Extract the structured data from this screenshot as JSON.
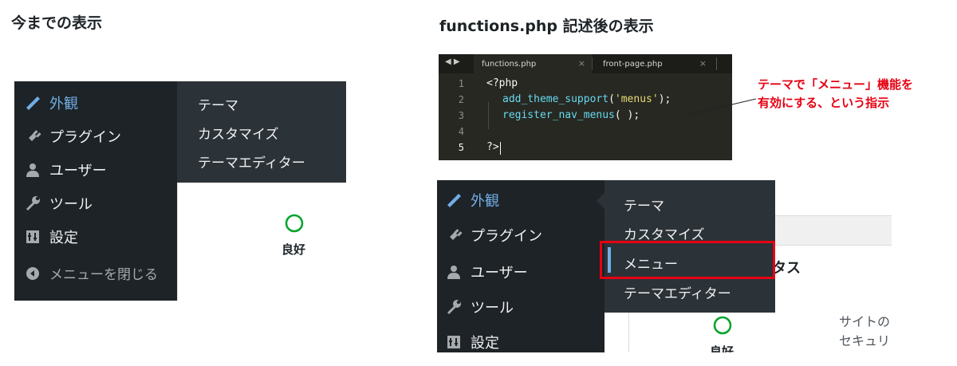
{
  "left_panel": {
    "heading": "今までの表示",
    "menu": [
      {
        "label": "外観",
        "icon": "paintbrush-icon",
        "active": true
      },
      {
        "label": "プラグイン",
        "icon": "plugin-icon"
      },
      {
        "label": "ユーザー",
        "icon": "user-icon"
      },
      {
        "label": "ツール",
        "icon": "wrench-icon"
      },
      {
        "label": "設定",
        "icon": "settings-icon"
      },
      {
        "label": "メニューを閉じる",
        "icon": "collapse-arrow-icon"
      }
    ],
    "submenu": [
      "テーマ",
      "カスタマイズ",
      "テーマエディター"
    ],
    "status": {
      "label": "良好"
    }
  },
  "right_panel": {
    "heading": "functions.php 記述後の表示",
    "editor": {
      "tabs": [
        {
          "name": "functions.php",
          "active": true
        },
        {
          "name": "front-page.php",
          "active": false
        }
      ],
      "nav_arrows": "◀ ▶",
      "close_glyph": "×",
      "line_numbers": [
        "1",
        "2",
        "3",
        "4",
        "5"
      ],
      "code": {
        "l1": "<?php",
        "l2_fn": "add_theme_support",
        "l2_open": "(",
        "l2_str": "'menus'",
        "l2_close": ");",
        "l3_fn": "register_nav_menus",
        "l3_rest": "( );",
        "l5": "?>"
      }
    },
    "annotation": {
      "line1": "テーマで「メニュー」機能を",
      "line2": "有効にする、という指示"
    },
    "menu": [
      {
        "label": "外観",
        "icon": "paintbrush-icon",
        "active": true
      },
      {
        "label": "プラグイン",
        "icon": "plugin-icon"
      },
      {
        "label": "ユーザー",
        "icon": "user-icon"
      },
      {
        "label": "ツール",
        "icon": "wrench-icon"
      },
      {
        "label": "設定",
        "icon": "settings-icon"
      }
    ],
    "submenu": [
      "テーマ",
      "カスタマイズ",
      "メニュー",
      "テーマエディター"
    ],
    "highlighted_item": "メニュー",
    "content": {
      "title_partial": "タス",
      "text_line1": "サイトの",
      "text_line2": "セキュリ",
      "status_label": "良好"
    },
    "colors": {
      "highlight": "#e60012",
      "active": "#72aee6",
      "menu_bg": "#1d2327",
      "submenu_bg": "#2c3338"
    }
  }
}
